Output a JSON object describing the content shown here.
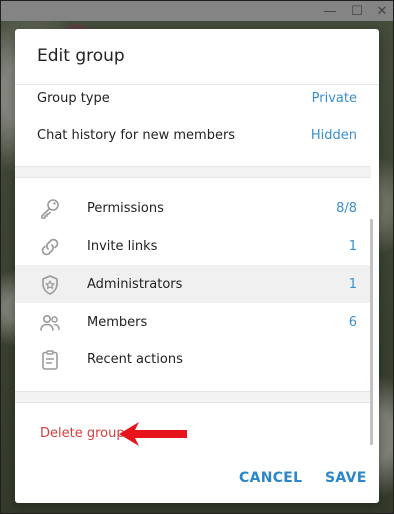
{
  "window": {
    "minimize_glyph": "—",
    "maximize_glyph": "☐",
    "close_glyph": "✕"
  },
  "dialog": {
    "title": "Edit group",
    "settings": [
      {
        "label": "Group type",
        "value": "Private"
      },
      {
        "label": "Chat history for new members",
        "value": "Hidden"
      }
    ],
    "items": [
      {
        "label": "Permissions",
        "count": "8/8",
        "icon": "key-icon"
      },
      {
        "label": "Invite links",
        "count": "1",
        "icon": "link-icon"
      },
      {
        "label": "Administrators",
        "count": "1",
        "icon": "admin-shield-icon"
      },
      {
        "label": "Members",
        "count": "6",
        "icon": "members-icon"
      },
      {
        "label": "Recent actions",
        "count": "",
        "icon": "clipboard-icon"
      }
    ],
    "delete_label": "Delete group",
    "cancel_label": "CANCEL",
    "save_label": "SAVE"
  },
  "colors": {
    "accent": "#3a8fcf",
    "danger": "#d13f3f",
    "annotation_arrow": "#e8141b"
  }
}
